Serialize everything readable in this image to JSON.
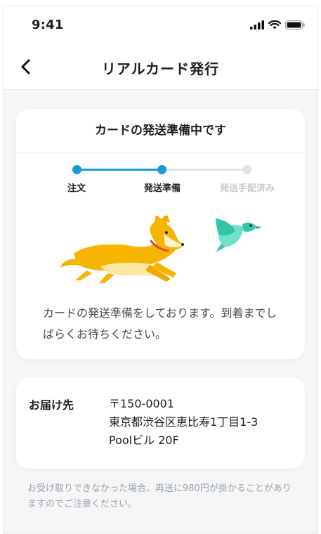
{
  "status_bar": {
    "time": "9:41"
  },
  "nav": {
    "title": "リアルカード発行",
    "back_icon": "chevron-left-icon"
  },
  "status_card": {
    "title": "カードの発送準備中です",
    "steps": [
      {
        "label": "注文",
        "state": "done"
      },
      {
        "label": "発送準備",
        "state": "current"
      },
      {
        "label": "発送手配済み",
        "state": "pending"
      }
    ],
    "message": "カードの発送準備をしております。到着までしばらくお待ちください。"
  },
  "address": {
    "label": "お届け先",
    "postal": "〒150-0001",
    "line1": "東京都渋谷区恵比寿1丁目1-3",
    "line2": "Poolビル 20F"
  },
  "note": "お受け取りできなかった場合、再送に980円が掛かることがありますのでご注意ください。",
  "colors": {
    "accent": "#1a9ad9",
    "pending": "#dce3e9",
    "pending_text": "#c6cdd3",
    "dog": "#f7b500",
    "bird": "#30c4a8"
  }
}
